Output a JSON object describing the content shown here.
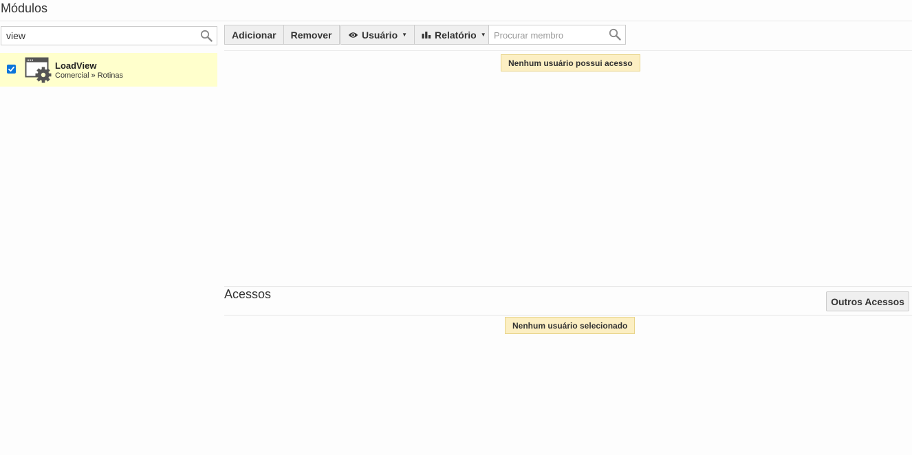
{
  "header": {
    "title": "Módulos"
  },
  "modules": {
    "search": {
      "value": "view",
      "icon": "search-icon"
    },
    "items": [
      {
        "name": "LoadView",
        "path": "Comercial » Rotinas",
        "checked": true,
        "icon": "window-gear-icon"
      }
    ]
  },
  "toolbar": {
    "add_label": "Adicionar",
    "remove_label": "Remover",
    "user_label": "Usuário",
    "user_icon": "eye-icon",
    "report_label": "Relatório",
    "report_icon": "bar-chart-icon",
    "member_search": {
      "placeholder": "Procurar membro",
      "value": ""
    }
  },
  "members": {
    "empty_message": "Nenhum usuário possui acesso"
  },
  "access": {
    "title": "Acessos",
    "other_button_label": "Outros Acessos",
    "empty_message": "Nenhum usuário selecionado"
  },
  "colors": {
    "selected_row": "#ffffcc",
    "alert_background": "#fcefc3",
    "checkbox": "#0a74da"
  }
}
